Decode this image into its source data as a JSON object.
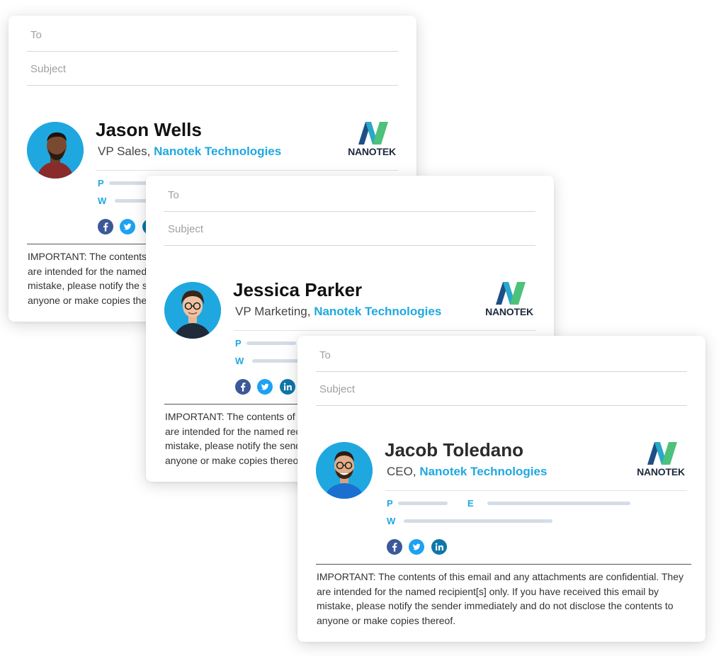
{
  "colors": {
    "accent": "#1fa8e0",
    "name": "#111111",
    "logo_text": "#1d2a3c",
    "facebook": "#3b5998",
    "twitter": "#1da1f2",
    "linkedin": "#0e76a8"
  },
  "cards": [
    {
      "to_placeholder": "To",
      "subject_placeholder": "Subject",
      "name": "Jason Wells",
      "role": "VP Sales",
      "comma": ",",
      "company": "Nanotek Technologies",
      "logo_text": "NANOTEK",
      "contact": {
        "p": "P",
        "w": "W"
      },
      "social": [
        "facebook-icon",
        "twitter-icon",
        "linkedin-icon"
      ],
      "disclaimer": "IMPORTANT: The contents of this email and any attachments are confidential. They are intended for the named recipient[s] only. If you have received this email by mistake, please notify the sender immediately and do not disclose the contents to anyone or make copies thereof."
    },
    {
      "to_placeholder": "To",
      "subject_placeholder": "Subject",
      "name": "Jessica Parker",
      "role": "VP Marketing",
      "comma": ",",
      "company": "Nanotek Technologies",
      "logo_text": "NANOTEK",
      "contact": {
        "p": "P",
        "w": "W"
      },
      "social": [
        "facebook-icon",
        "twitter-icon",
        "linkedin-icon"
      ],
      "disclaimer": "IMPORTANT: The contents of this email and any attachments are confidential. They are intended for the named recipient[s] only. If you have received this email by mistake, please notify the sender immediately and do not disclose the contents to anyone or make copies thereof."
    },
    {
      "to_placeholder": "To",
      "subject_placeholder": "Subject",
      "name": "Jacob Toledano",
      "role": "CEO",
      "comma": ",",
      "company": "Nanotek Technologies",
      "logo_text": "NANOTEK",
      "contact": {
        "p": "P",
        "e": "E",
        "w": "W"
      },
      "social": [
        "facebook-icon",
        "twitter-icon",
        "linkedin-icon"
      ],
      "disclaimer": "IMPORTANT: The contents of this email and any attachments are confidential. They are intended for the named recipient[s] only. If you have received this email by mistake, please notify the sender immediately and do not disclose the contents to anyone or make copies thereof."
    }
  ]
}
